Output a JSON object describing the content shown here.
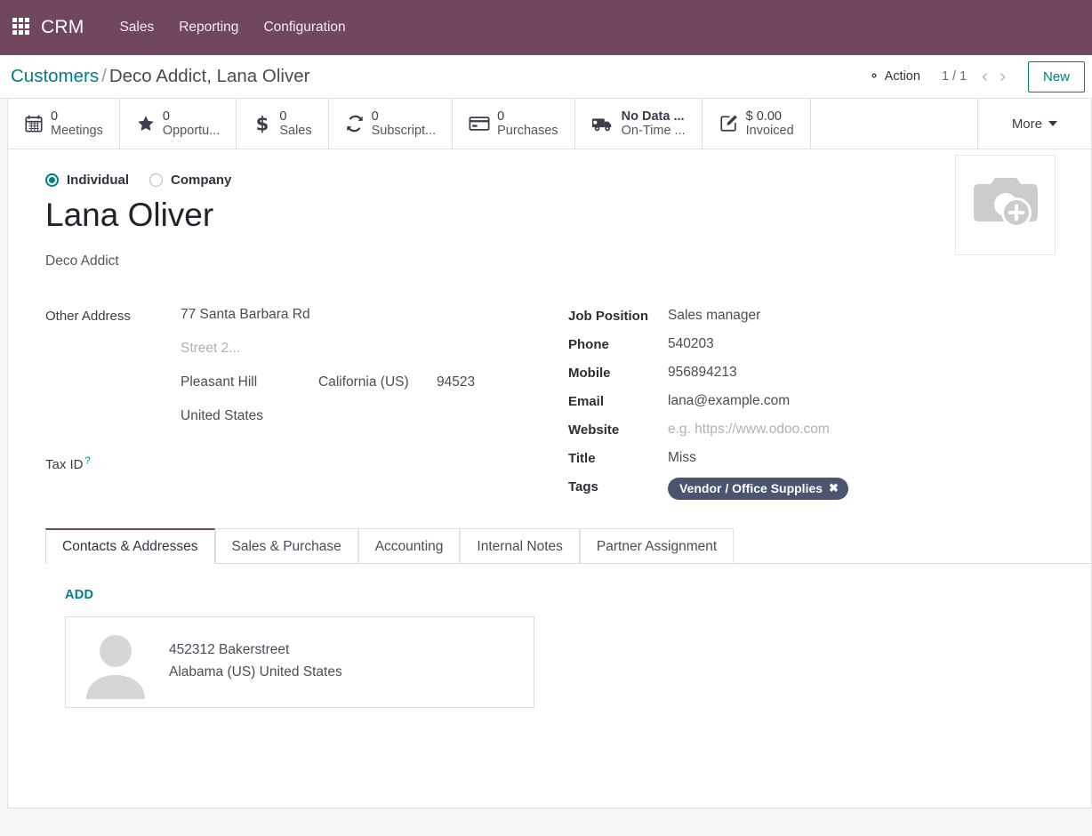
{
  "navbar": {
    "apps_icon": "apps-grid-icon",
    "brand": "CRM",
    "menus": [
      {
        "label": "Sales"
      },
      {
        "label": "Reporting"
      },
      {
        "label": "Configuration"
      }
    ],
    "background_color": "#71475e"
  },
  "control_panel": {
    "breadcrumb_root": "Customers",
    "breadcrumb_separator": "/",
    "breadcrumb_current": "Deco Addict, Lana Oliver",
    "action_label": "Action",
    "action_icon": "gear-icon",
    "pager": "1 / 1",
    "prev_icon": "chevron-left-icon",
    "next_icon": "chevron-right-icon",
    "prev_glyph": "‹",
    "next_glyph": "›",
    "new_label": "New",
    "accent_color": "#017e84"
  },
  "stat_buttons": [
    {
      "icon": "calendar-icon",
      "value": "0",
      "label": "Meetings",
      "bold": false
    },
    {
      "icon": "star-icon",
      "value": "0",
      "label": "Opportu...",
      "bold": false
    },
    {
      "icon": "dollar-icon",
      "value": "0",
      "label": "Sales",
      "bold": false
    },
    {
      "icon": "refresh-icon",
      "value": "0",
      "label": "Subscript...",
      "bold": false
    },
    {
      "icon": "credit-card-icon",
      "value": "0",
      "label": "Purchases",
      "bold": false
    },
    {
      "icon": "truck-icon",
      "value": "No Data ...",
      "label": "On-Time ...",
      "bold": true
    },
    {
      "icon": "pencil-square-icon",
      "value": "$ 0.00",
      "label": "Invoiced",
      "bold": false
    }
  ],
  "more_button": {
    "label": "More",
    "icon": "chevron-down-icon"
  },
  "form": {
    "company_type": {
      "selected": "Individual",
      "options": [
        {
          "label": "Individual",
          "checked": true
        },
        {
          "label": "Company",
          "checked": false
        }
      ]
    },
    "record_name": "Lana Oliver",
    "parent_company": "Deco Addict",
    "image_placeholder_icon": "camera-add-icon",
    "address": {
      "label": "Other Address",
      "street": "77 Santa Barbara Rd",
      "street2_placeholder": "Street 2...",
      "city": "Pleasant Hill",
      "state": "California (US)",
      "zip": "94523",
      "country": "United States"
    },
    "tax_id": {
      "label": "Tax ID",
      "hint": "?",
      "value": ""
    },
    "right_fields": [
      {
        "label": "Job Position",
        "value": "Sales manager",
        "placeholder": false
      },
      {
        "label": "Phone",
        "value": "540203",
        "placeholder": false
      },
      {
        "label": "Mobile",
        "value": "956894213",
        "placeholder": false
      },
      {
        "label": "Email",
        "value": "lana@example.com",
        "placeholder": false
      },
      {
        "label": "Website",
        "value": "e.g. https://www.odoo.com",
        "placeholder": true
      },
      {
        "label": "Title",
        "value": "Miss",
        "placeholder": false
      }
    ],
    "tags": {
      "label": "Tags",
      "items": [
        {
          "name": "Vendor / Office Supplies",
          "remove_icon": "close-icon",
          "color": "#4a5670"
        }
      ]
    }
  },
  "notebook": {
    "tabs": [
      {
        "label": "Contacts & Addresses",
        "active": true
      },
      {
        "label": "Sales & Purchase",
        "active": false
      },
      {
        "label": "Accounting",
        "active": false
      },
      {
        "label": "Internal Notes",
        "active": false
      },
      {
        "label": "Partner Assignment",
        "active": false
      }
    ],
    "add_label": "ADD",
    "contacts": [
      {
        "avatar_icon": "user-avatar-placeholder-icon",
        "line1": "452312 Bakerstreet",
        "line2": "Alabama (US) United States"
      }
    ]
  }
}
